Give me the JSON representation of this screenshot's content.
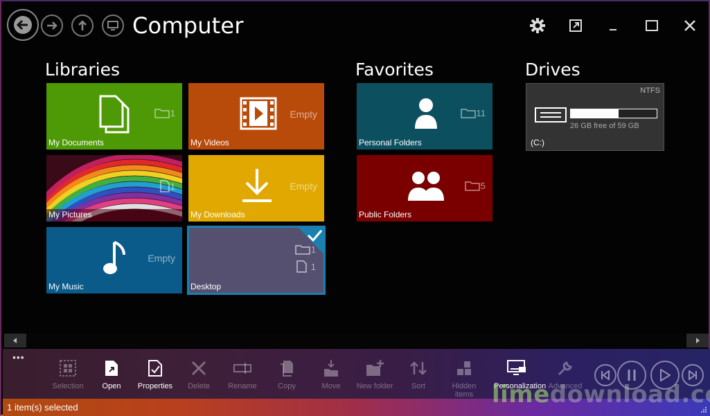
{
  "window": {
    "title": "Computer"
  },
  "sections": {
    "libraries": "Libraries",
    "favorites": "Favorites",
    "drives": "Drives"
  },
  "libraries": [
    {
      "name": "My Documents",
      "count": "1",
      "color": "#4e9a06"
    },
    {
      "name": "My Videos",
      "status": "Empty",
      "color": "#b84a0a"
    },
    {
      "name": "My Pictures",
      "count": "1"
    },
    {
      "name": "My Downloads",
      "status": "Empty",
      "color": "#e0a800"
    },
    {
      "name": "My Music",
      "status": "Empty",
      "color": "#0a5a8a"
    },
    {
      "name": "Desktop",
      "folders": "1",
      "files": "1",
      "color": "#555070",
      "selected": true
    }
  ],
  "favorites": [
    {
      "name": "Personal Folders",
      "count": "11",
      "color": "#0c5060"
    },
    {
      "name": "Public Folders",
      "count": "5",
      "color": "#7a0000"
    }
  ],
  "drives": [
    {
      "name": "(C:)",
      "fs": "NTFS",
      "free_text": "26 GB free of 59 GB",
      "used_fraction": 0.56
    }
  ],
  "appbar": {
    "more": "•••",
    "commands": [
      {
        "label": "Selection",
        "enabled": false
      },
      {
        "label": "Open",
        "enabled": true
      },
      {
        "label": "Properties",
        "enabled": true
      },
      {
        "label": "Delete",
        "enabled": false
      },
      {
        "label": "Rename",
        "enabled": false
      },
      {
        "label": "Copy",
        "enabled": false
      },
      {
        "label": "Move",
        "enabled": false
      },
      {
        "label": "New folder",
        "enabled": false
      },
      {
        "label": "Sort",
        "enabled": false
      },
      {
        "label": "Hidden items",
        "enabled": false
      },
      {
        "label": "Personalization",
        "enabled": true
      },
      {
        "label": "Advanced",
        "enabled": false
      }
    ]
  },
  "status": {
    "text": "1 item(s) selected"
  },
  "watermark": {
    "part1": "lime",
    "part2": "download.com"
  }
}
